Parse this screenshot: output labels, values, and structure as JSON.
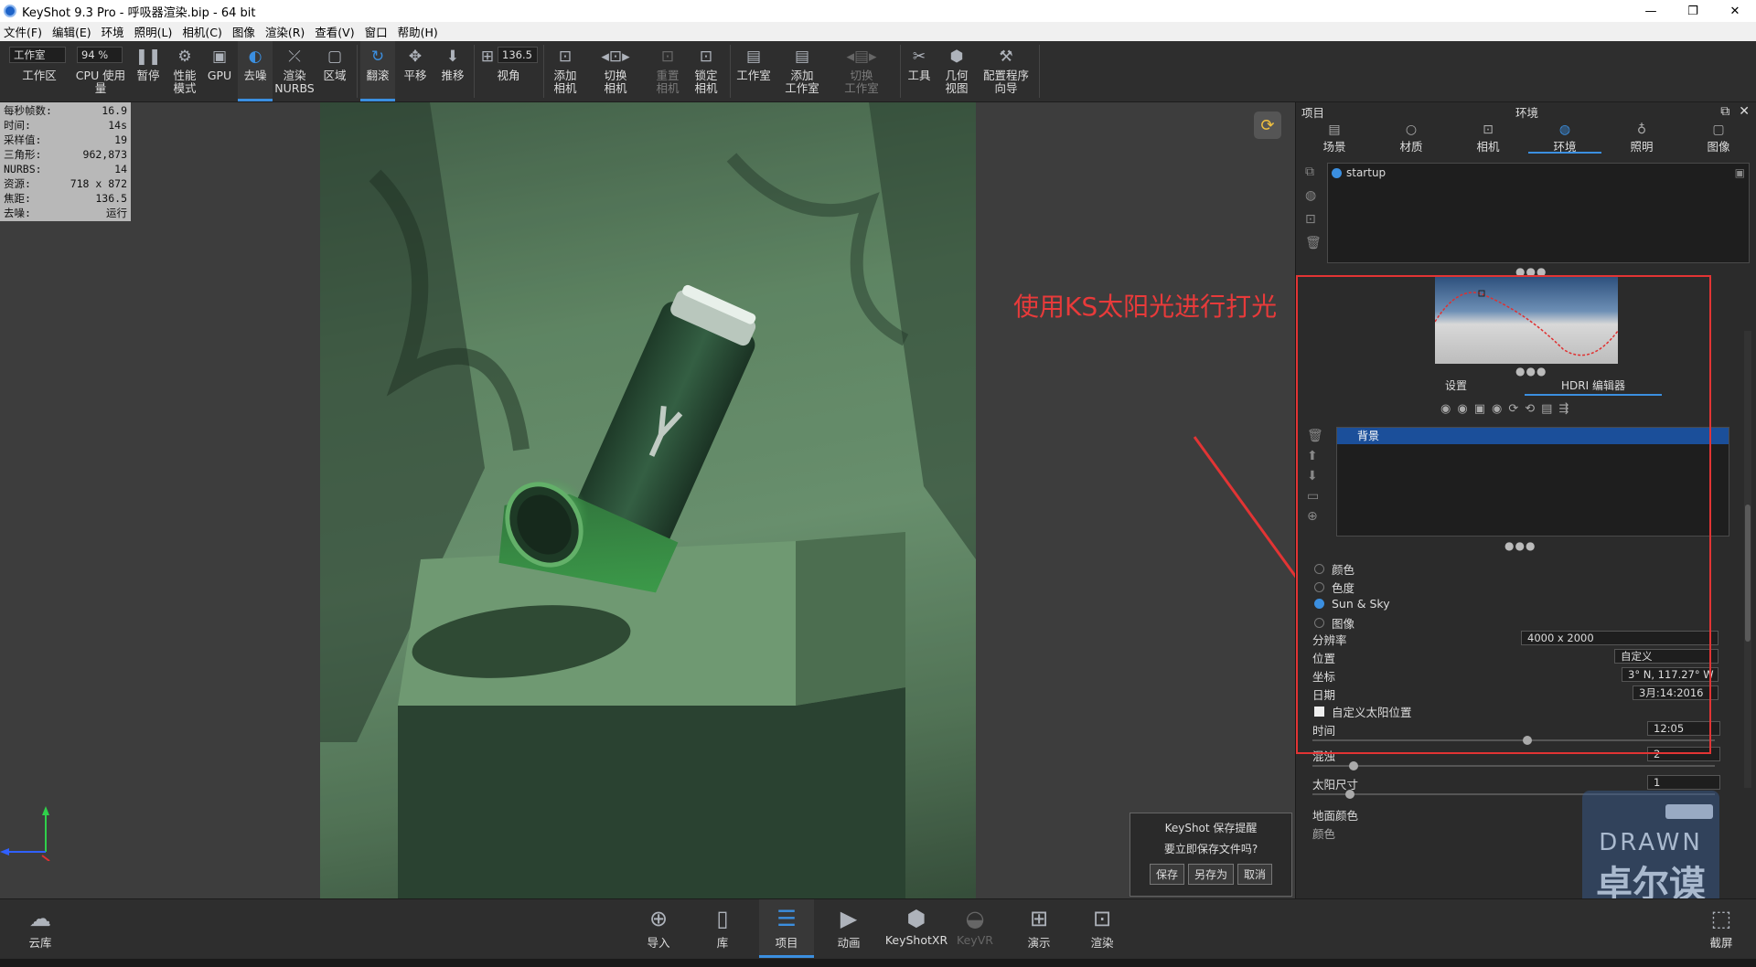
{
  "window": {
    "title": "KeyShot 9.3 Pro  - 呼吸器渲染.bip  - 64 bit",
    "minimize": "—",
    "restore": "❐",
    "close": "✕"
  },
  "menu": [
    "文件(F)",
    "编辑(E)",
    "环境",
    "照明(L)",
    "相机(C)",
    "图像",
    "渲染(R)",
    "查看(V)",
    "窗口",
    "帮助(H)"
  ],
  "toolbar": {
    "workspace_select": "工作室",
    "workspace_label": "工作区",
    "cpu_value": "94 %",
    "cpu_label": "CPU 使用量",
    "pause": "暂停",
    "perf": "性能\n模式",
    "gpu": "GPU",
    "denoise": "去噪",
    "nurbs": "渲染\nNURBS",
    "region": "区域",
    "tumble": "翻滚",
    "pan": "平移",
    "dolly": "推移",
    "fov_value": "136.5",
    "fov_label": "视角",
    "add_camera": "添加\n相机",
    "switch_camera": "切换\n相机",
    "reset_camera": "重置\n相机",
    "lock_camera": "锁定\n相机",
    "studio": "工作室",
    "add_studio": "添加\n工作室",
    "switch_studio": "切换\n工作室",
    "tools": "工具",
    "geometry_view": "几何\n视图",
    "config_wizard": "配置程序\n向导"
  },
  "stats": [
    {
      "k": "每秒帧数:",
      "v": "16.9"
    },
    {
      "k": "时间:",
      "v": "14s"
    },
    {
      "k": "采样值:",
      "v": "19"
    },
    {
      "k": "三角形:",
      "v": "962,873"
    },
    {
      "k": "NURBS:",
      "v": "14"
    },
    {
      "k": "资源:",
      "v": "718 x 872"
    },
    {
      "k": "焦距:",
      "v": "136.5"
    },
    {
      "k": "去噪:",
      "v": "运行"
    }
  ],
  "annotation": "使用KS太阳光进行打光",
  "save_prompt": {
    "title": "KeyShot 保存提醒",
    "question": "要立即保存文件吗?",
    "save": "保存",
    "save_as": "另存为",
    "cancel": "取消"
  },
  "panel": {
    "project": "项目",
    "header": "环境",
    "tabs": [
      "场景",
      "材质",
      "相机",
      "环境",
      "照明",
      "图像"
    ],
    "env_item": "startup",
    "subtabs": [
      "设置",
      "HDRI 编辑器"
    ],
    "layer": "背景",
    "options": [
      "颜色",
      "色度",
      "Sun & Sky",
      "图像"
    ],
    "resolution_label": "分辨率",
    "resolution": "4000 x 2000",
    "location_label": "位置",
    "location": "自定义",
    "coords_label": "坐标",
    "coords": "3° N, 117.27° W",
    "date_label": "日期",
    "date": "3月:14:2016",
    "custom_sun": "自定义太阳位置",
    "time_label": "时间",
    "time": "12:05",
    "turbidity_label": "混浊",
    "turbidity": "2",
    "sun_size_label": "太阳尺寸",
    "sun_size": "1",
    "ground_label": "地面颜色",
    "next_label": "颜色"
  },
  "bottom": {
    "cloud": "云库",
    "import": "导入",
    "library": "库",
    "project": "项目",
    "animation": "动画",
    "keyshotxr": "KeyShotXR",
    "keyvr": "KeyVR",
    "present": "演示",
    "render": "渲染",
    "screenshot": "截屏"
  },
  "watermark": {
    "en": "DRAWN",
    "cn": "卓尔谟"
  }
}
